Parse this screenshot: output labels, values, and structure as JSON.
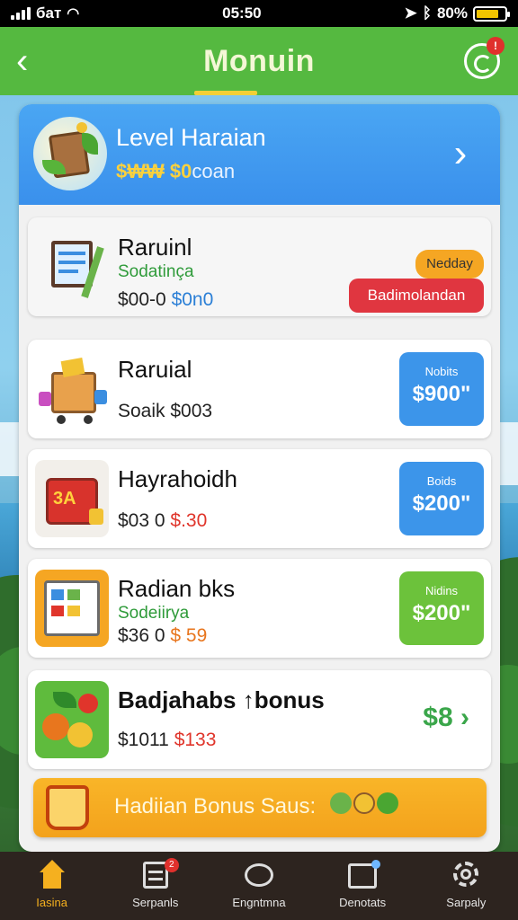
{
  "status_bar": {
    "carrier": "бат",
    "time": "05:50",
    "battery_text": "80%",
    "battery_level": 0.8
  },
  "header": {
    "title": "Monuin",
    "notification_count": "!"
  },
  "level_card": {
    "title": "Level Haraian",
    "subtitle_coins": "$₩₩ $0",
    "subtitle_rest": "coan"
  },
  "items": [
    {
      "title": "Raruinl",
      "subtitle": "Sodatinça",
      "price_a": "$00-0",
      "price_b": "$0n0",
      "tag_top": "Nedday",
      "tag_bottom": "Badimolandan"
    },
    {
      "title": "Raruial",
      "price_a": "Soaik",
      "price_b": "$003",
      "button_small": "Nobits",
      "button_big": "$900\""
    },
    {
      "title": "Hayrahoidh",
      "price_a": "$03 0",
      "price_b": "$.30",
      "thumb_label": "3A",
      "button_small": "Boids",
      "button_big": "$200\""
    },
    {
      "title": "Radian bks",
      "subtitle": "Sodeiirya",
      "price_a": "$36 0",
      "price_b": "$ 59",
      "button_small": "Nidins",
      "button_big": "$200\""
    },
    {
      "title": "Badjahabs ↑bonus",
      "price_a": "$1011",
      "price_b": "$133",
      "bonus_price": "$8 ›"
    }
  ],
  "bonus_bar": {
    "text": "Hadiian Bonus Saus:"
  },
  "tabbar": [
    {
      "label": "Iasina",
      "badge": ""
    },
    {
      "label": "Serpanls",
      "badge": "2"
    },
    {
      "label": "Engntmna",
      "badge": ""
    },
    {
      "label": "Denotats",
      "badge": ""
    },
    {
      "label": "Sarpaly",
      "badge": ""
    }
  ],
  "colors": {
    "header_green": "#55b940",
    "level_blue": "#3a90ec",
    "accent_orange": "#f5a623",
    "alert_red": "#e03640",
    "price_blue": "#3c95ea",
    "price_green": "#6cc23b",
    "tab_active": "#f5b01f"
  }
}
